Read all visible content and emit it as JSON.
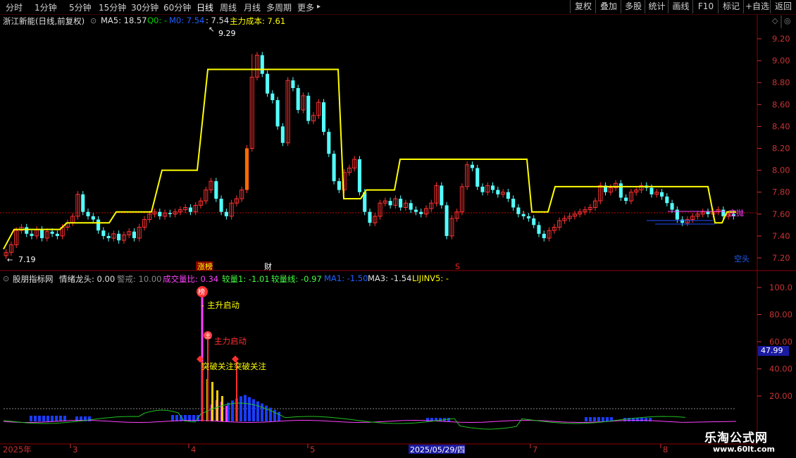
{
  "toolbar": {
    "tabs": [
      "分时",
      "1分钟",
      "5分钟",
      "15分钟",
      "30分钟",
      "60分钟",
      "日线",
      "周线",
      "月线",
      "多周期",
      "更多"
    ],
    "active_tab": "日线",
    "more_arrow": "▸",
    "right_buttons": [
      "复权",
      "叠加",
      "多股",
      "统计",
      "画线",
      "F10",
      "标记",
      "+自选",
      "返回"
    ]
  },
  "main_info": {
    "stock": "浙江新能(日线,前复权)",
    "ma5": "MA5: 18.57",
    "q0": "Q0: -",
    "m0": "M0: 7.54",
    "m1": ": 7.54",
    "cost": "主力成本: 7.61"
  },
  "sub_info": {
    "name": "股朋指标网",
    "qxlt": "情绪龙头: 0.00",
    "jj": "警戒: 10.00",
    "cjlb": "成交量比: 0.34",
    "jl1": "较量1: -1.01",
    "jlx": "较量线: -0.97",
    "ma1": "MA1: -1.50",
    "ma3": "MA3: -1.54",
    "lij": "LIJINV5: -"
  },
  "annotations": {
    "high": "9.29",
    "low": "7.19",
    "long_label": "涨榜",
    "cai": "财",
    "s_mark": "S",
    "right_signal": "庄抛",
    "kongtou": "空头",
    "zhusheng": "主升启动",
    "zhuli": "主力启动",
    "tupo": "突破关注突破关注",
    "badge_bang": "榜",
    "badge_zhu": "主"
  },
  "y_axis_main": [
    "9.20",
    "9.00",
    "8.80",
    "8.60",
    "8.40",
    "8.20",
    "8.00",
    "7.80",
    "7.60",
    "7.40",
    "7.20"
  ],
  "y_axis_sub": [
    "100.0",
    "80.00",
    "60.00",
    "40.00",
    "20.00"
  ],
  "sub_price_badge": "47.99",
  "x_axis": {
    "labels": [
      "2025年",
      "3",
      "4",
      "5",
      "6",
      "7",
      "8"
    ],
    "cursor_date": "2025/05/29/四"
  },
  "watermark": {
    "name": "乐淘公式网",
    "url": "www.60lt.com"
  },
  "colors": {
    "up": "#ff3232",
    "down": "#54ffff",
    "bg": "#000000",
    "cost_line": "#ffff00",
    "axis": "#c83232"
  }
}
